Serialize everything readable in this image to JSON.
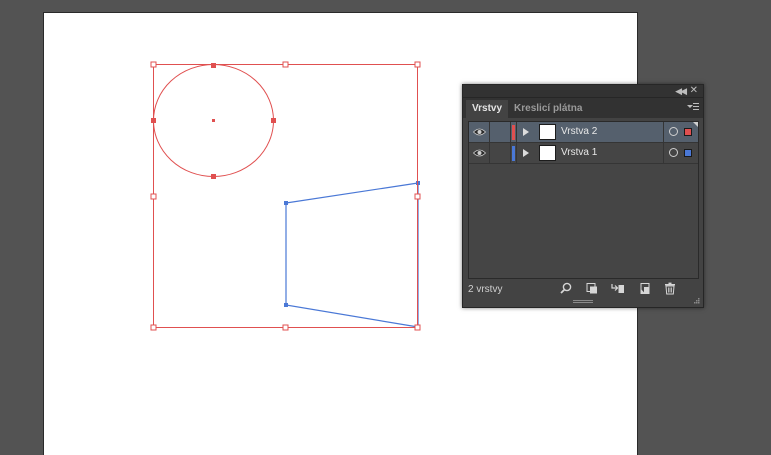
{
  "panel": {
    "tabs": [
      {
        "label": "Vrstvy",
        "active": true
      },
      {
        "label": "Kreslicí plátna",
        "active": false
      }
    ],
    "layers": [
      {
        "name": "Vrstva 2",
        "color": "#e05050",
        "selected": true
      },
      {
        "name": "Vrstva 1",
        "color": "#4a78d6",
        "selected": false
      }
    ],
    "footer_status": "2 vrstvy",
    "footer_buttons": [
      "search-icon",
      "clipping-mask-icon",
      "new-sublayer-icon",
      "new-layer-icon",
      "trash-icon"
    ]
  },
  "colors": {
    "pasteboard": "#535353",
    "artboard": "#ffffff",
    "layer2_selection": "#e05050",
    "layer1_selection": "#4a78d6"
  }
}
